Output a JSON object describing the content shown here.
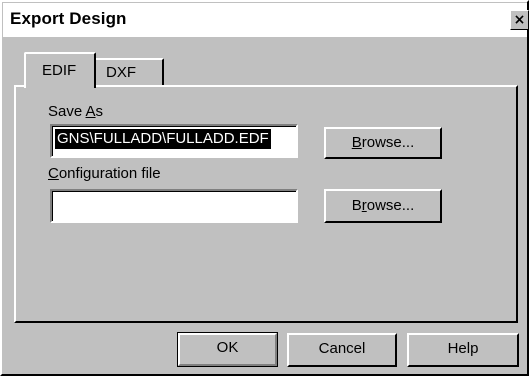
{
  "window": {
    "title": "Export Design",
    "close_symbol": "×"
  },
  "tabs": [
    {
      "label": "EDIF",
      "active": true
    },
    {
      "label": "DXF",
      "active": false
    }
  ],
  "save_as": {
    "label_prefix": "Save ",
    "label_underlined": "A",
    "label_suffix": "s",
    "value": "GNS\\FULLADD\\FULLADD.EDF",
    "browse_label_underlined": "B",
    "browse_label_rest": "rowse..."
  },
  "config_file": {
    "label_underlined": "C",
    "label_rest": "onfiguration file",
    "value": "",
    "browse_label_prefix": "B",
    "browse_label_underlined": "r",
    "browse_label_rest": "owse..."
  },
  "footer": {
    "ok_label": "OK",
    "cancel_label": "Cancel",
    "help_label": "Help"
  },
  "icons": {
    "close": "close-icon"
  },
  "colors": {
    "face": "#c0c0c0",
    "highlight": "#ffffff",
    "shadow": "#808080",
    "dark": "#000000",
    "selection": "#000000"
  }
}
